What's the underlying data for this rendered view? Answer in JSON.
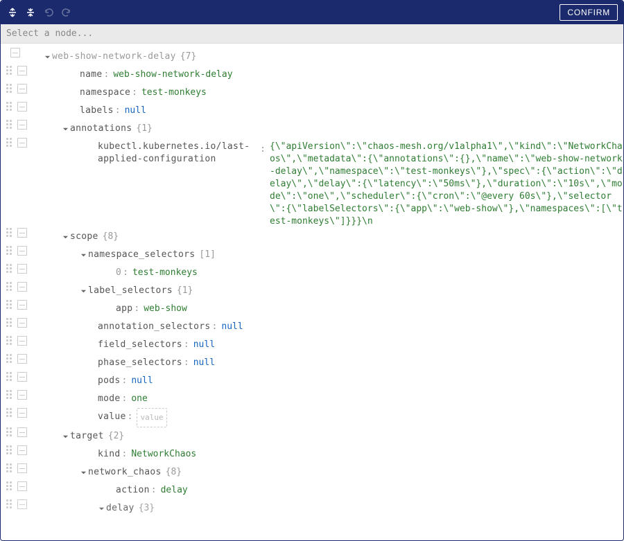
{
  "toolbar": {
    "confirm_label": "CONFIRM"
  },
  "search": {
    "placeholder": "Select a node..."
  },
  "tree": {
    "root": {
      "key": "web-show-network-delay",
      "count": "{7}"
    },
    "name": {
      "key": "name",
      "value": "web-show-network-delay"
    },
    "namespace": {
      "key": "namespace",
      "value": "test-monkeys"
    },
    "labels": {
      "key": "labels",
      "value": "null"
    },
    "annotations": {
      "key": "annotations",
      "count": "{1}"
    },
    "annotation_kv": {
      "key": "kubectl.kubernetes.io/last-applied-configuration",
      "value": "{\\\"apiVersion\\\":\\\"chaos-mesh.org/v1alpha1\\\",\\\"kind\\\":\\\"NetworkChaos\\\",\\\"metadata\\\":{\\\"annotations\\\":{},\\\"name\\\":\\\"web-show-network-delay\\\",\\\"namespace\\\":\\\"test-monkeys\\\"},\\\"spec\\\":{\\\"action\\\":\\\"delay\\\",\\\"delay\\\":{\\\"latency\\\":\\\"50ms\\\"},\\\"duration\\\":\\\"10s\\\",\\\"mode\\\":\\\"one\\\",\\\"scheduler\\\":{\\\"cron\\\":\\\"@every 60s\\\"},\\\"selector\\\":{\\\"labelSelectors\\\":{\\\"app\\\":\\\"web-show\\\"},\\\"namespaces\\\":[\\\"test-monkeys\\\"]}}}\\n"
    },
    "scope": {
      "key": "scope",
      "count": "{8}"
    },
    "ns_sel": {
      "key": "namespace_selectors",
      "count": "[1]"
    },
    "ns_0": {
      "key": "0",
      "value": "test-monkeys"
    },
    "lbl_sel": {
      "key": "label_selectors",
      "count": "{1}"
    },
    "lbl_app": {
      "key": "app",
      "value": "web-show"
    },
    "ann_sel": {
      "key": "annotation_selectors",
      "value": "null"
    },
    "fld_sel": {
      "key": "field_selectors",
      "value": "null"
    },
    "ph_sel": {
      "key": "phase_selectors",
      "value": "null"
    },
    "pods": {
      "key": "pods",
      "value": "null"
    },
    "mode": {
      "key": "mode",
      "value": "one"
    },
    "value": {
      "key": "value",
      "placeholder": "value"
    },
    "target": {
      "key": "target",
      "count": "{2}"
    },
    "kind": {
      "key": "kind",
      "value": "NetworkChaos"
    },
    "nc": {
      "key": "network_chaos",
      "count": "{8}"
    },
    "action": {
      "key": "action",
      "value": "delay"
    },
    "delay": {
      "key": "delay",
      "count": "{3}"
    }
  }
}
